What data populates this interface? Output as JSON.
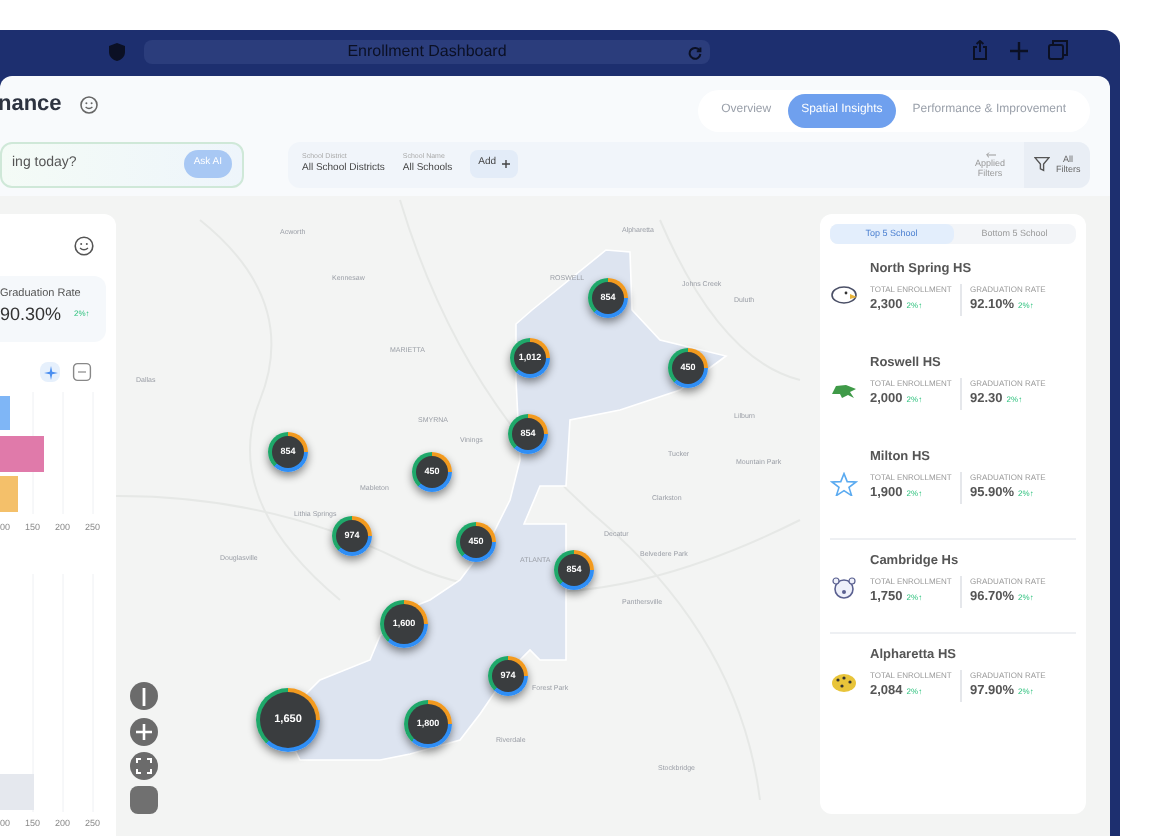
{
  "browser": {
    "title": "Enrollment Dashboard"
  },
  "header": {
    "title": "nance"
  },
  "tabs": [
    {
      "label": "Overview",
      "selected": false
    },
    {
      "label": "Spatial Insights",
      "selected": true
    },
    {
      "label": "Performance & Improvement",
      "selected": false
    }
  ],
  "ask": {
    "placeholder": "ing today?",
    "button": "Ask AI"
  },
  "filters": [
    {
      "label": "School District",
      "value": "All School Districts"
    },
    {
      "label": "School Name",
      "value": "All Schools"
    }
  ],
  "add_button": "Add",
  "applied_filters": "Applied Filters",
  "all_filters": "All Filters",
  "left_panel": {
    "metric": {
      "label": "Graduation Rate",
      "value": "90.30%",
      "change": "2%↑"
    },
    "chart_1_ticks": [
      "00",
      "150",
      "200",
      "250"
    ],
    "chart_2_ticks": [
      "00",
      "150",
      "200",
      "250"
    ]
  },
  "map": {
    "labels": [
      "Acworth",
      "Alpharetta",
      "Kennesaw",
      "ROSWELL",
      "Johns Creek",
      "Duluth",
      "MARIETTA",
      "SMYRNA",
      "Vinings",
      "Tucker",
      "Mableton",
      "Clarkston",
      "Lithia Springs",
      "Decatur",
      "Douglasville",
      "ATLANTA",
      "Belvedere Park",
      "Panthersville",
      "Forest Park",
      "Riverdale",
      "Stockbridge",
      "Lilburn",
      "Mountain Park",
      "Dallas"
    ],
    "markers": [
      {
        "value": "854",
        "kind": "small"
      },
      {
        "value": "1,012",
        "kind": "small"
      },
      {
        "value": "450",
        "kind": "small"
      },
      {
        "value": "854",
        "kind": "small"
      },
      {
        "value": "854",
        "kind": "small"
      },
      {
        "value": "450",
        "kind": "small"
      },
      {
        "value": "974",
        "kind": "small"
      },
      {
        "value": "450",
        "kind": "small"
      },
      {
        "value": "854",
        "kind": "small"
      },
      {
        "value": "1,600",
        "kind": "medium"
      },
      {
        "value": "974",
        "kind": "small"
      },
      {
        "value": "1,650",
        "kind": "large"
      },
      {
        "value": "1,800",
        "kind": "medium"
      }
    ]
  },
  "ranking": {
    "tabs": [
      {
        "label": "Top 5 School",
        "selected": true
      },
      {
        "label": "Bottom 5 School",
        "selected": false
      }
    ],
    "schools": [
      {
        "name": "North Spring HS",
        "enrollment_label": "TOTAL ENROLLMENT",
        "enrollment": "2,300",
        "enrollment_change": "2%↑",
        "rate_label": "GRADUATION RATE",
        "rate": "92.10%",
        "rate_change": "2%↑"
      },
      {
        "name": "Roswell HS",
        "enrollment_label": "TOTAL ENROLLMENT",
        "enrollment": "2,000",
        "enrollment_change": "2%↑",
        "rate_label": "GRADUATION RATE",
        "rate": "92.30",
        "rate_change": "2%↑"
      },
      {
        "name": "Milton HS",
        "enrollment_label": "TOTAL ENROLLMENT",
        "enrollment": "1,900",
        "enrollment_change": "2%↑",
        "rate_label": "GRADUATION RATE",
        "rate": "95.90%",
        "rate_change": "2%↑"
      },
      {
        "name": "Cambridge Hs",
        "enrollment_label": "TOTAL ENROLLMENT",
        "enrollment": "1,750",
        "enrollment_change": "2%↑",
        "rate_label": "GRADUATION RATE",
        "rate": "96.70%",
        "rate_change": "2%↑"
      },
      {
        "name": "Alpharetta HS",
        "enrollment_label": "TOTAL ENROLLMENT",
        "enrollment": "2,084",
        "enrollment_change": "2%↑",
        "rate_label": "GRADUATION RATE",
        "rate": "97.90%",
        "rate_change": "2%↑"
      }
    ]
  }
}
